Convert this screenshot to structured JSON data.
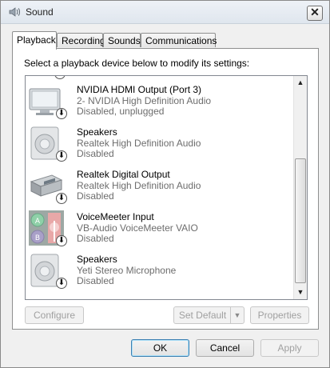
{
  "window": {
    "title": "Sound",
    "close_label": "✕"
  },
  "tabs": [
    {
      "label": "Playback",
      "active": true
    },
    {
      "label": "Recording",
      "active": false
    },
    {
      "label": "Sounds",
      "active": false
    },
    {
      "label": "Communications",
      "active": false
    }
  ],
  "instruction": "Select a playback device below to modify its settings:",
  "devices": [
    {
      "name": "NVIDIA HDMI Output (Port 3)",
      "description": "2- NVIDIA High Definition Audio",
      "status": "Disabled, unplugged",
      "icon": "monitor-icon"
    },
    {
      "name": "Speakers",
      "description": "Realtek High Definition Audio",
      "status": "Disabled",
      "icon": "speaker-icon"
    },
    {
      "name": "Realtek Digital Output",
      "description": "Realtek High Definition Audio",
      "status": "Disabled",
      "icon": "digital-output-icon"
    },
    {
      "name": "VoiceMeeter Input",
      "description": "VB-Audio VoiceMeeter VAIO",
      "status": "Disabled",
      "icon": "voicemeeter-icon"
    },
    {
      "name": "Speakers",
      "description": "Yeti Stereo Microphone",
      "status": "Disabled",
      "icon": "speaker-icon"
    }
  ],
  "buttons": {
    "configure": "Configure",
    "set_default": "Set Default",
    "properties": "Properties",
    "ok": "OK",
    "cancel": "Cancel",
    "apply": "Apply"
  },
  "colors": {
    "disabled_text": "#6d6d6d",
    "selection_border": "#3c7fb1"
  }
}
